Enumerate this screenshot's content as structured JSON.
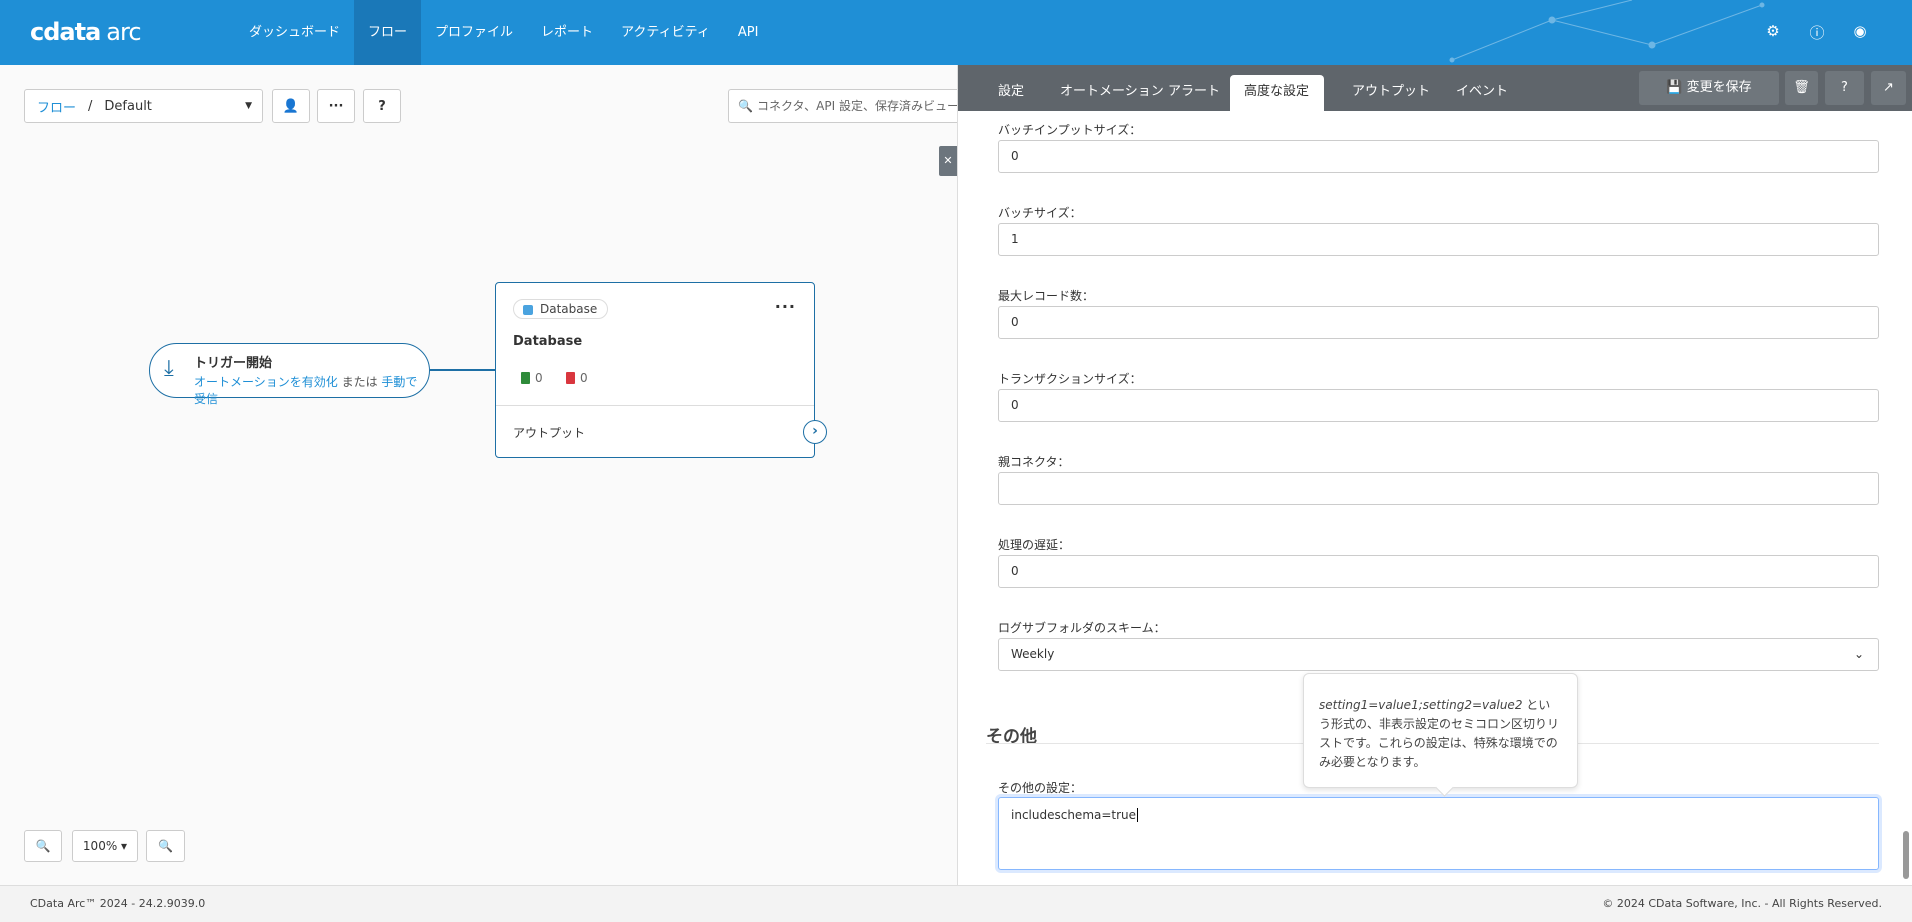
{
  "header": {
    "logo": "cdata",
    "logo_suffix": "arc",
    "nav": [
      "ダッシュボード",
      "フロー",
      "プロファイル",
      "レポート",
      "アクティビティ",
      "API"
    ],
    "active_nav": 1
  },
  "canvas": {
    "breadcrumb_root": "フロー",
    "breadcrumb_sep": "/",
    "breadcrumb_current": "Default",
    "search_placeholder": "コネクタ、API 設定、保存済みビュー、メ",
    "trigger": {
      "title": "トリガー開始",
      "sub1": "オートメーションを有効化",
      "sub_or": " または ",
      "sub2": "手動で受信"
    },
    "node": {
      "badge": "Database",
      "name": "Database",
      "success": "0",
      "error": "0",
      "output": "アウトプット"
    },
    "zoom_level": "100%"
  },
  "panel": {
    "tabs": [
      "設定",
      "オートメーション",
      "アラート",
      "高度な設定",
      "アウトプット",
      "イベント"
    ],
    "active_tab": 3,
    "save_label": "変更を保存",
    "fields": [
      {
        "label": "バッチインプットサイズ：",
        "value": "0"
      },
      {
        "label": "バッチサイズ：",
        "value": "1"
      },
      {
        "label": "最大レコード数：",
        "value": "0"
      },
      {
        "label": "トランザクションサイズ：",
        "value": "0"
      },
      {
        "label": "親コネクタ：",
        "value": ""
      },
      {
        "label": "処理の遅延：",
        "value": "0"
      },
      {
        "label": "ログサブフォルダのスキーム：",
        "value": "Weekly"
      }
    ],
    "section": "その他",
    "other_label": "その他の設定：",
    "other_value": "includeschema=true",
    "tooltip_code": "setting1=value1;setting2=value2",
    "tooltip_text": " という形式の、非表示設定のセミコロン区切りリストです。これらの設定は、特殊な環境でのみ必要となります。"
  },
  "footer": {
    "left": "CData Arc™ 2024 - 24.2.9039.0",
    "right": "© 2024 CData Software, Inc. - All Rights Reserved."
  },
  "colors": {
    "header": "#1f8fd6",
    "panel_tabs": "#5f656b",
    "node_border": "#1d6fa5"
  }
}
